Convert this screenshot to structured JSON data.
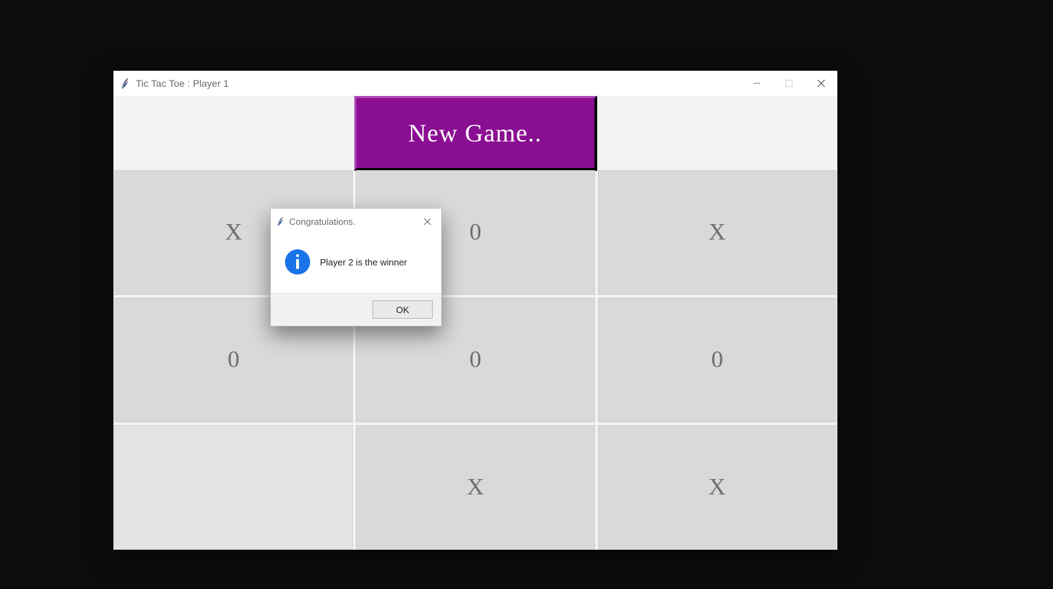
{
  "window": {
    "title": "Tic Tac Toe : Player 1"
  },
  "header": {
    "new_game_label": "New Game.."
  },
  "board": {
    "cells": [
      "X",
      "0",
      "X",
      "0",
      "0",
      "0",
      "",
      "X",
      "X"
    ]
  },
  "dialog": {
    "title": "Congratulations.",
    "message": "Player 2 is the winner",
    "ok_label": "OK"
  },
  "colors": {
    "accent": "#8a0e92",
    "mark": "#6e6e6e"
  }
}
